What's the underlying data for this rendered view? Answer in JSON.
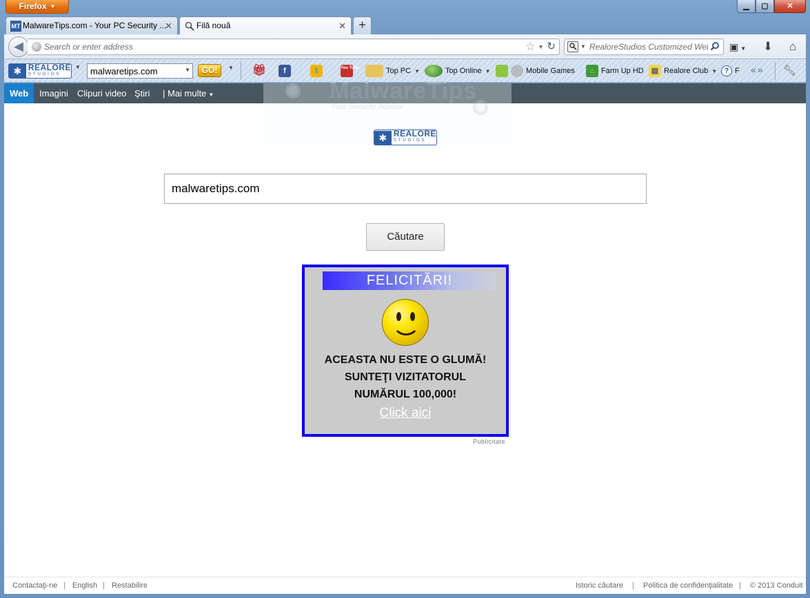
{
  "browser": {
    "menu_button": "Firefox",
    "window_controls": {
      "minimize": "▁",
      "maximize": "▢",
      "close": "✕"
    },
    "tabs": [
      {
        "title": "MalwareTips.com - Your PC Security ...",
        "favicon": "MT",
        "active": false
      },
      {
        "title": "Filă nouă",
        "favicon": "search-icon",
        "active": true
      }
    ],
    "new_tab": "+",
    "address_placeholder": "Search or enter address",
    "search_placeholder": "RealoreStudios Customized Web"
  },
  "toolbar": {
    "logo_big": "REALORE",
    "logo_small": "STUDIOS",
    "search_value": "malwaretips.com",
    "go_label": "GO!",
    "items": [
      {
        "label": "Top PC",
        "icon": "folder-icon"
      },
      {
        "label": "Top Online",
        "icon": "globe-icon"
      },
      {
        "label": "Mobile Games",
        "icon": "android-apple-icon"
      },
      {
        "label": "Farm Up HD",
        "icon": "farm-icon"
      },
      {
        "label": "Realore Club",
        "icon": "club-icon"
      },
      {
        "label": "F",
        "icon": "help-icon"
      }
    ],
    "youtube_label": "You Tube"
  },
  "page": {
    "nav": {
      "web": "Web",
      "images": "Imagini",
      "videos": "Clipuri video",
      "news": "Ştiri",
      "more": "| Mai multe"
    },
    "watermark": {
      "title": "MalwareTips",
      "subtitle": "Your Security Advisor"
    },
    "search_value": "malwaretips.com",
    "search_button": "Căutare",
    "ad": {
      "header": "FELICITĂRI!",
      "line1": "ACEASTA NU ESTE O GLUMĂ!",
      "line2": "SUNTEŢI VIZITATORUL",
      "line3": "NUMĂRUL 100,000!",
      "link": "Click aici",
      "label": "Publicitate"
    },
    "footer": {
      "contact": "Contactaţi-ne",
      "english": "English",
      "restore": "Restabilire",
      "history": "Istoric căutare",
      "privacy": "Politica de confidenţialitate",
      "copyright": "© 2013 Conduit"
    }
  },
  "colors": {
    "ad_border": "#0b00ee",
    "nav_active": "#1a7fcd",
    "nav_bar": "#46555f",
    "firefox_orange": "#e2700f"
  }
}
